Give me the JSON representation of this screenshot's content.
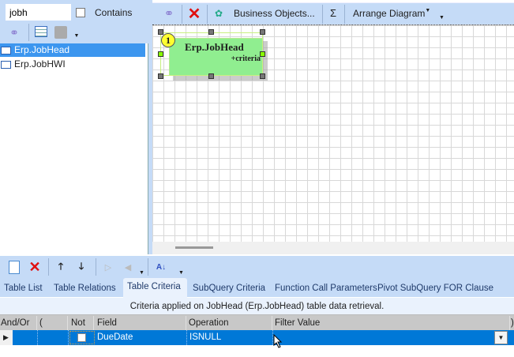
{
  "search": {
    "value": "jobh",
    "contains_label": "Contains"
  },
  "tables": [
    {
      "name": "Erp.JobHead",
      "selected": true
    },
    {
      "name": "Erp.JobHWI",
      "selected": false
    }
  ],
  "diagram_toolbar": {
    "business_objects": "Business Objects...",
    "sigma": "Σ",
    "arrange": "Arrange Diagram"
  },
  "node": {
    "badge": "1",
    "title": "Erp.JobHead",
    "sub": "+criteria"
  },
  "tabs": [
    "Table List",
    "Table Relations",
    "Table Criteria",
    "SubQuery Criteria",
    "Function Call Parameters",
    "Pivot SubQuery FOR Clause"
  ],
  "active_tab": "Table Criteria",
  "caption": "Criteria applied on JobHead (Erp.JobHead)  table data retrieval.",
  "grid": {
    "headers": [
      "And/Or",
      "(",
      "Not",
      "Field",
      "Operation",
      "Filter Value",
      ")"
    ],
    "rows": [
      {
        "and_or": "",
        "paren": "",
        "not": false,
        "field": "DueDate",
        "operation": "ISNULL",
        "filter_value": ""
      }
    ]
  },
  "colors": {
    "panel": "#c5dbf7",
    "selection": "#0078d7",
    "node": "#90ee90"
  }
}
